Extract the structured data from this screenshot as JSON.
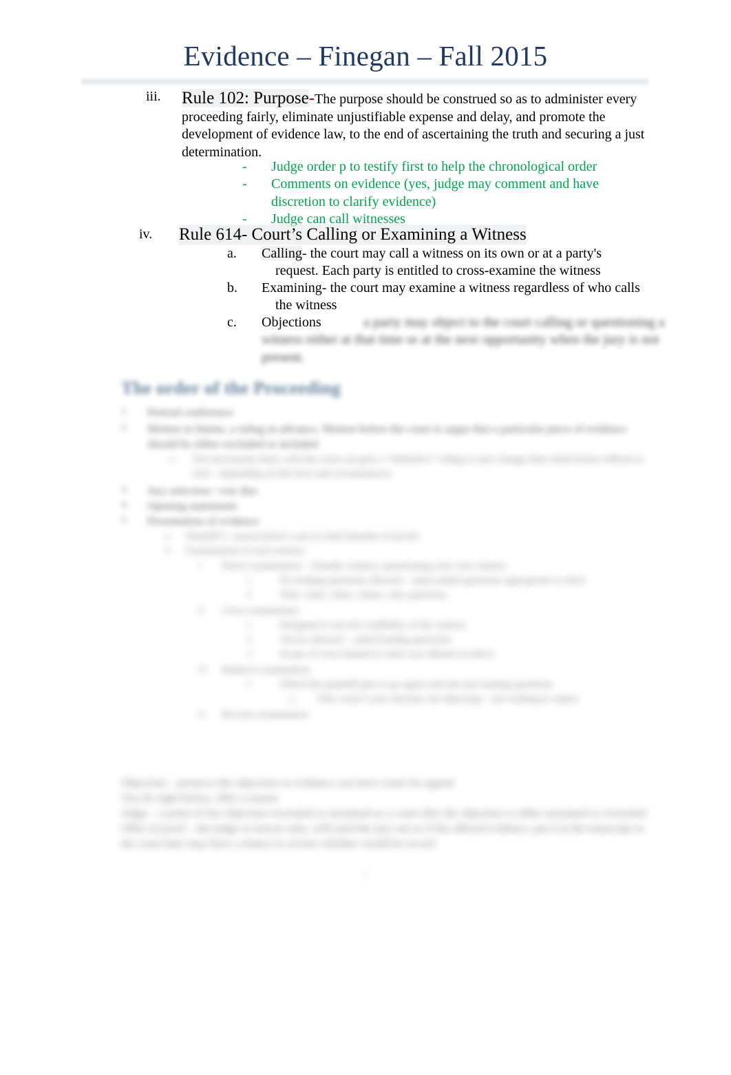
{
  "document": {
    "title": "Evidence – Finegan – Fall 2015",
    "page_number": "1",
    "colors": {
      "title_blue": "#1F3864",
      "accent_green": "#00A550",
      "accent_red": "#C00000",
      "heading_blue": "#2E5076",
      "body_black": "#000000",
      "highlight_grey": "#E2E5E9"
    }
  },
  "outline": {
    "rule_102": {
      "marker": "iii.",
      "heading": "Rule 102: Purpose",
      "dash": "-",
      "body": "The purpose should be construed so as to administer every proceeding fairly, eliminate unjustifiable expense and delay, and promote the development of evidence law, to the end of ascertaining the truth and securing a just determination.",
      "bullets": [
        {
          "marker": "-",
          "text": "Judge order p to testify first to help the chronological order"
        },
        {
          "marker": "-",
          "text": "Comments on evidence (yes, judge may comment and have discretion to clarify evidence)"
        },
        {
          "marker": "-",
          "text": "Judge can call witnesses"
        }
      ]
    },
    "rule_614": {
      "marker": "iv.",
      "heading": "Rule 614- Court’s Calling or Examining a Witness",
      "items": [
        {
          "marker": "a.",
          "lead": "Calling",
          "dash": "-",
          "text": " the court may call a witness on its own or at a party's request.   Each party is entitled to cross-examine the witness"
        },
        {
          "marker": "b.",
          "lead": "Examining",
          "dash": "-",
          "text": " the court may examine a witness regardless of who calls the witness"
        },
        {
          "marker": "c.",
          "lead": "Objections",
          "dash": "",
          "text": " a party may object to the court calling or questioning a witness either at that time or at the next opportunity when the jury is not present."
        }
      ]
    }
  },
  "order_section": {
    "heading": "The order of the Proceeding",
    "items": [
      {
        "marker": "1.",
        "text": "Pretrial conference"
      },
      {
        "marker": "2.",
        "text": "Motion in limine, a ruling in advance. Motion before the court to argue that a particular piece of evidence should be either excluded or included",
        "subs": [
          {
            "marker": "a.",
            "text": "Not necessarily final, well the court can give a “definitive” ruling or may change their mind before offered at trial – depending on the facts and circumstances"
          }
        ]
      },
      {
        "marker": "3.",
        "text": "Jury selection / voir dire"
      },
      {
        "marker": "4.",
        "text": "Opening statements"
      },
      {
        "marker": "5.",
        "text": "Presentation of evidence",
        "subs": [
          {
            "marker": "a.",
            "text": "Plaintiff’s / prosecution’s case in chief (burden of proof)"
          },
          {
            "marker": "b.",
            "text": "Examination of each witness",
            "subs": [
              {
                "marker": "i.",
                "text": "Direct examination – friendly witness, questioning your own witness",
                "subs": [
                  {
                    "marker": "1.",
                    "text": "No leading questions allowed – open-ended questions appropriate to elicit"
                  },
                  {
                    "marker": "2.",
                    "text": "Who, what, when, where, why questions"
                  }
                ]
              },
              {
                "marker": "ii.",
                "text": "Cross examination",
                "subs": [
                  {
                    "marker": "1.",
                    "text": "Designed to test the credibility of the witness"
                  },
                  {
                    "marker": "2.",
                    "text": "Yes/no allowed – asked leading questions"
                  },
                  {
                    "marker": "3.",
                    "text": "Scope of cross limited to what was offered on direct"
                  }
                ]
              },
              {
                "marker": "iii.",
                "text": "Redirect examination",
                "subs": [
                  {
                    "marker": "1.",
                    "text": "Which the plaintiff gets to go again and ask non-leading questions",
                    "subs": [
                      {
                        "marker": "a.",
                        "text": "Why wasn’t your attorney not objecting – not wishing to object"
                      }
                    ]
                  }
                ]
              },
              {
                "marker": "iv.",
                "text": "Recross examination"
              }
            ]
          }
        ]
      }
    ]
  },
  "closing_notes": [
    "Objection – preserve the objection so evidence can leave room for appeal",
    "You do right before, offer a reason",
    "Judge – a point of law objection overruled or sustained so a court after the objection is either sustained or overruled",
    "Offer of proof – the judge or lawyer asks, will need the jury out so if the offered evidence, put it in the transcript so the court later may have a chance to review whether would be record"
  ]
}
